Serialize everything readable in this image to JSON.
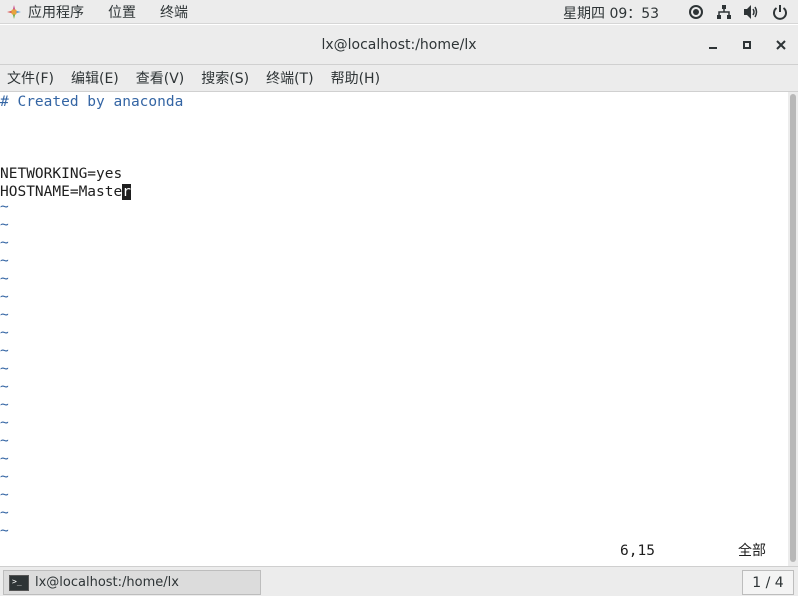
{
  "top_panel": {
    "applications": "应用程序",
    "places": "位置",
    "terminal": "终端",
    "clock": "星期四 09：53",
    "tray_icons": [
      "display-brightness-icon",
      "network-wired-icon",
      "volume-icon",
      "power-icon"
    ]
  },
  "window": {
    "title": "lx@localhost:/home/lx",
    "minimize": "–",
    "maximize": "▫",
    "close": "✕"
  },
  "menubar": {
    "items": [
      "文件(F)",
      "编辑(E)",
      "查看(V)",
      "搜索(S)",
      "终端(T)",
      "帮助(H)"
    ]
  },
  "editor": {
    "comment": "# Created by anaconda",
    "line1": "NETWORKING=yes",
    "line2_before_cursor": "HOSTNAME=Maste",
    "line2_cursor_char": "r",
    "tilde": "~",
    "status_position": "6,15",
    "status_scope": "全部"
  },
  "taskbar": {
    "task_label": "lx@localhost:/home/lx",
    "workspace": "1 / 4"
  },
  "colors": {
    "comment_blue": "#3465a4",
    "panel_bg": "#ececec"
  }
}
